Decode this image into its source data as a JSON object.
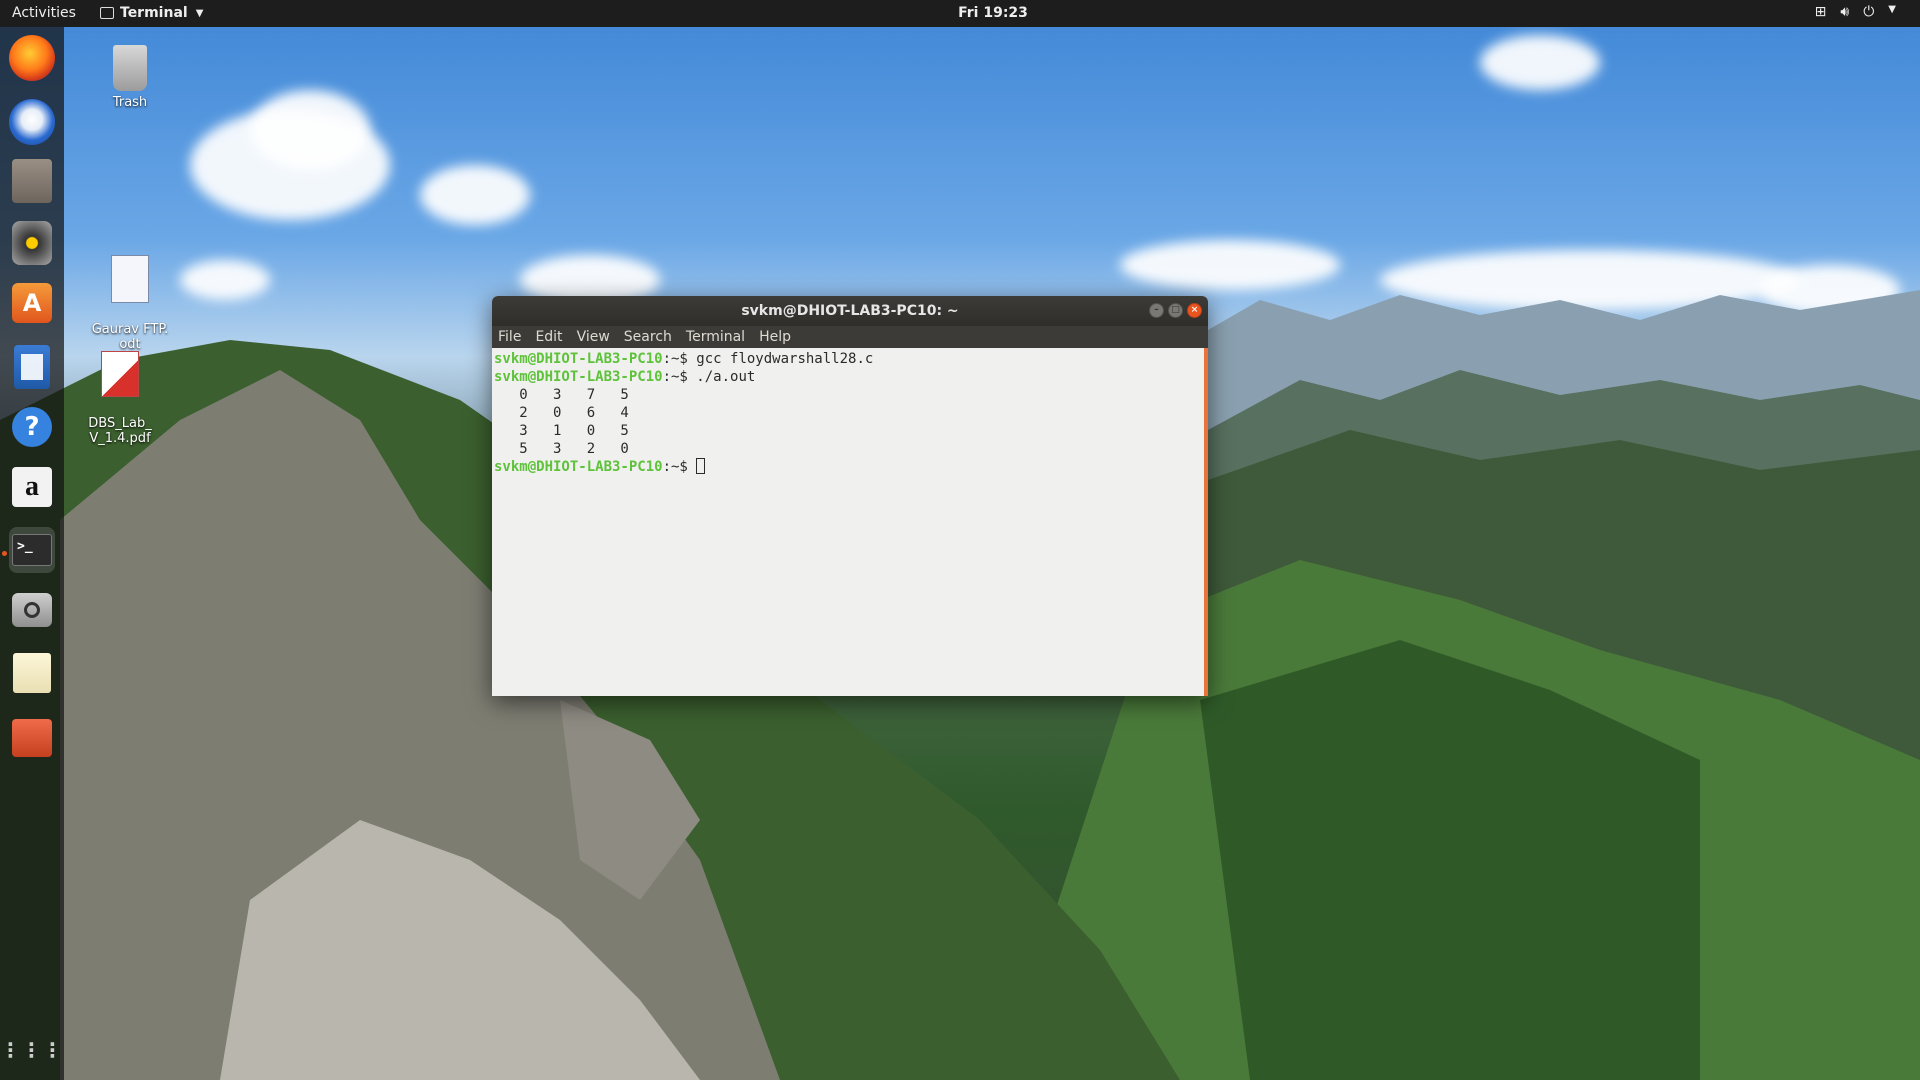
{
  "topbar": {
    "activities": "Activities",
    "app_name": "Terminal",
    "clock": "Fri 19:23"
  },
  "dock": {
    "apps": [
      "firefox-icon",
      "thunderbird-icon",
      "files-icon",
      "rhythmbox-icon",
      "software-center-icon",
      "writer-icon",
      "help-icon",
      "amazon-icon",
      "terminal-icon",
      "screenshot-icon",
      "text-editor-icon",
      "archive-icon",
      "show-apps-icon"
    ],
    "amazon_glyph": "a",
    "help_glyph": "?"
  },
  "desktop": {
    "icons": [
      {
        "label": "Trash"
      },
      {
        "label": "Gaurav FTP.\nodt"
      },
      {
        "label": "DBS_Lab_\nV_1.4.pdf"
      }
    ]
  },
  "terminal": {
    "title": "svkm@DHIOT-LAB3-PC10: ~",
    "menu": [
      "File",
      "Edit",
      "View",
      "Search",
      "Terminal",
      "Help"
    ],
    "prompt": "svkm@DHIOT-LAB3-PC10",
    "prompt_suffix": ":~$ ",
    "commands": [
      "gcc floydwarshall28.c",
      "./a.out"
    ],
    "output": [
      "   0   3   7   5",
      "   2   0   6   4",
      "   3   1   0   5",
      "   5   3   2   0"
    ]
  },
  "colors": {
    "accent": "#e95420",
    "prompt": "#5ec23b"
  }
}
